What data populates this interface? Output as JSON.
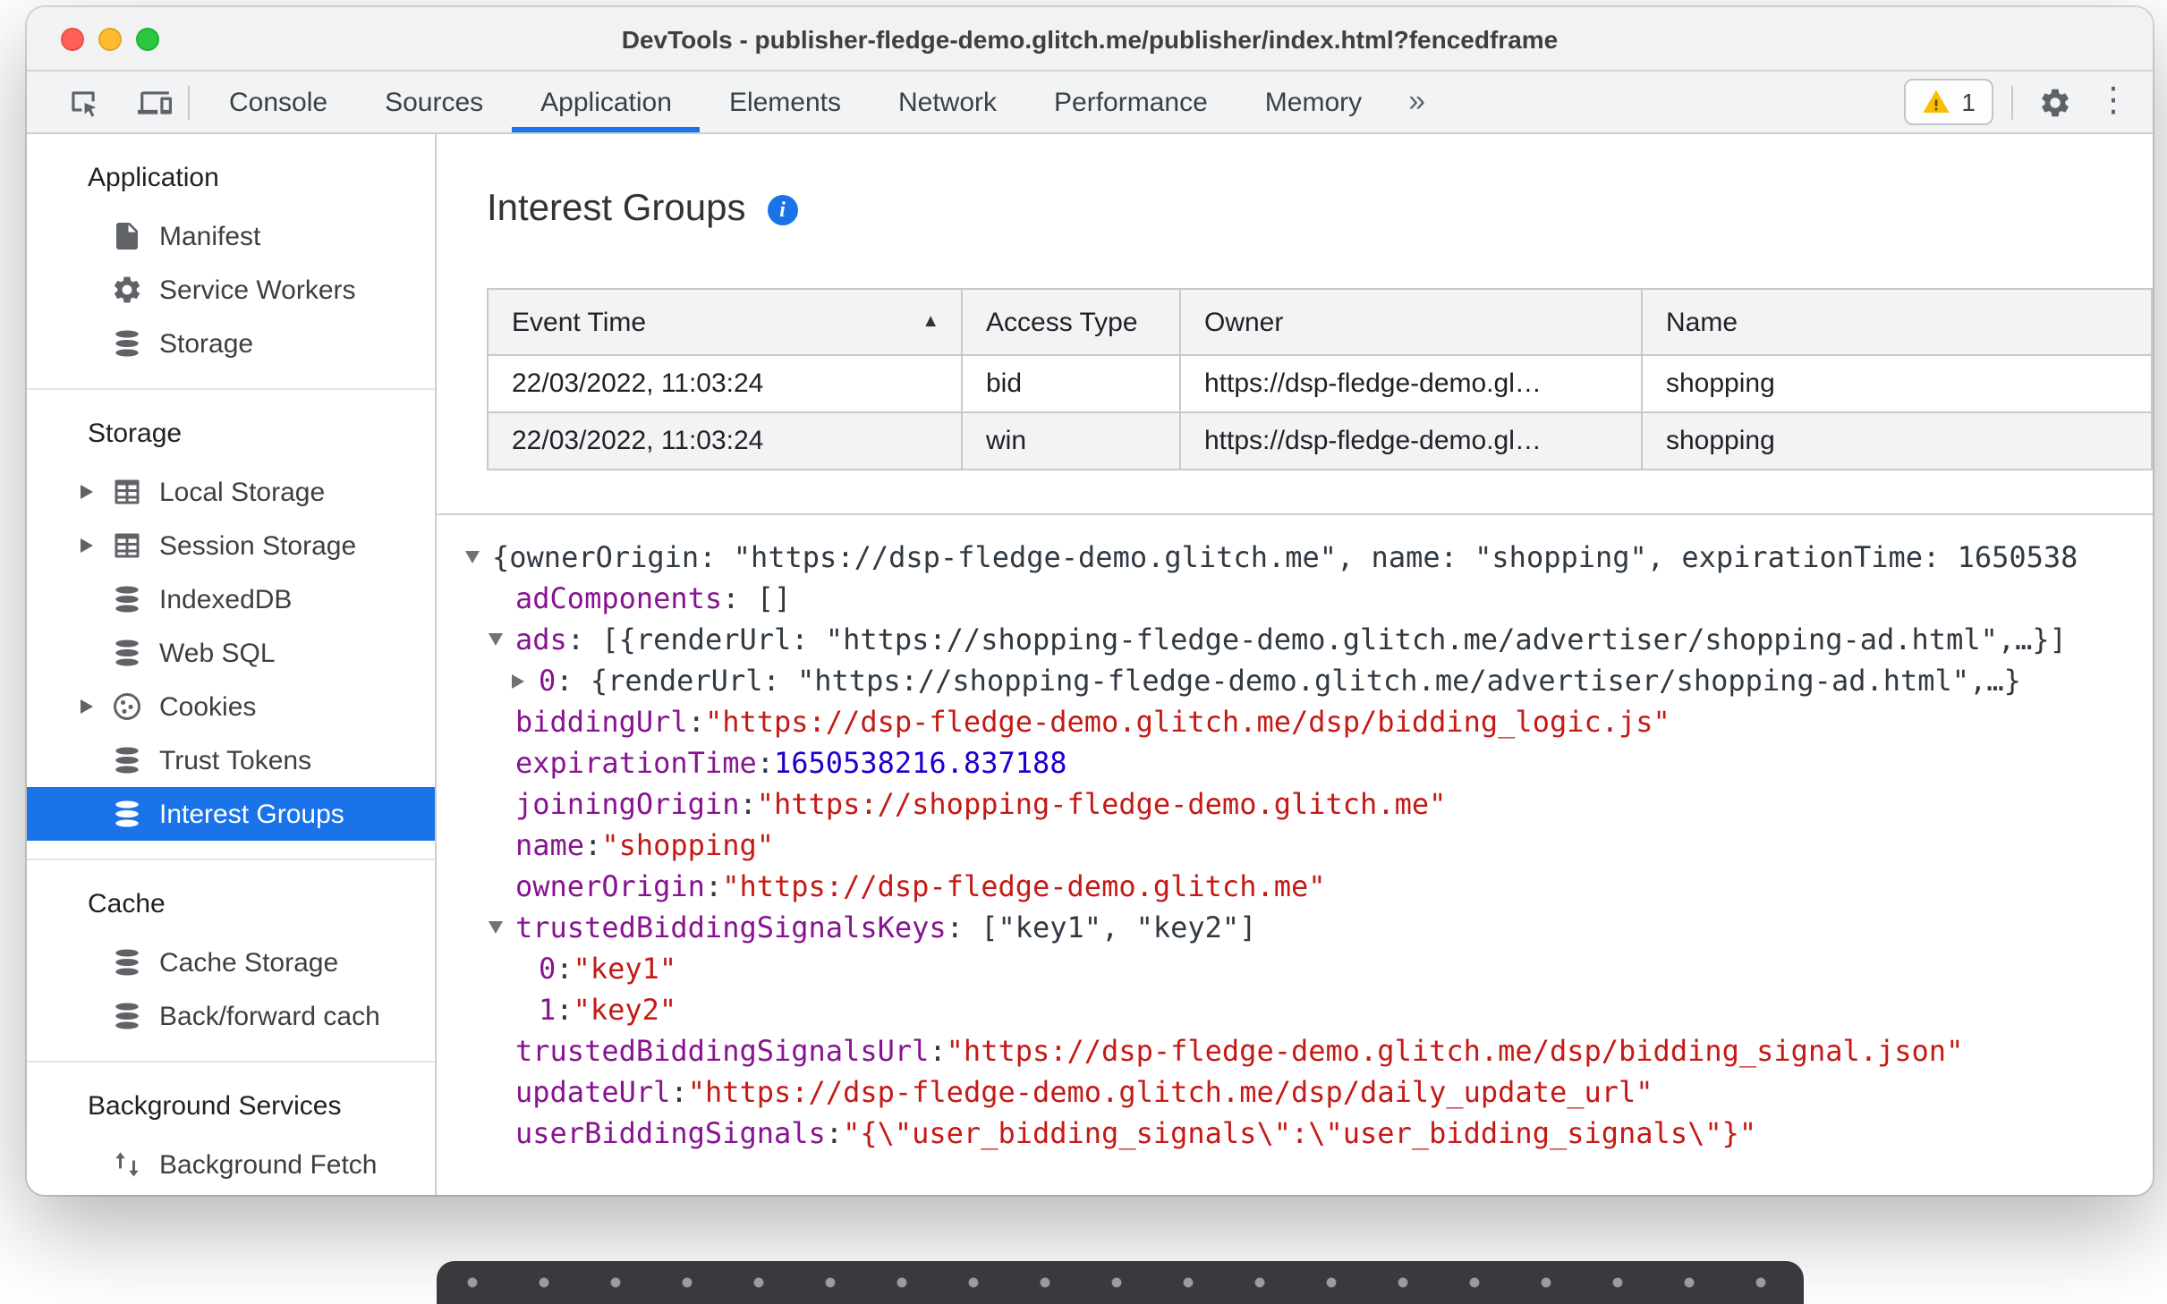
{
  "colors": {
    "accent": "#1a73e8",
    "tree_key": "#881391",
    "tree_string": "#c41a16",
    "tree_number": "#1c00cf",
    "warning": "#fbbc04",
    "selected_bg": "#1a73e8",
    "selected_text": "#ffffff"
  },
  "window": {
    "title": "DevTools - publisher-fledge-demo.glitch.me/publisher/index.html?fencedframe"
  },
  "toolbar": {
    "left_icons": [
      "inspect-icon",
      "device-toolbar-icon"
    ],
    "tabs": [
      {
        "label": "Console",
        "active": false
      },
      {
        "label": "Sources",
        "active": false
      },
      {
        "label": "Application",
        "active": true
      },
      {
        "label": "Elements",
        "active": false
      },
      {
        "label": "Network",
        "active": false
      },
      {
        "label": "Performance",
        "active": false
      },
      {
        "label": "Memory",
        "active": false
      }
    ],
    "more_tabs_glyph": "»",
    "warning_count": "1",
    "right_icons": [
      "warning-icon",
      "settings-gear-icon",
      "more-options-kebab-icon"
    ],
    "kebab_glyph": "⋮"
  },
  "sidebar": {
    "sections": [
      {
        "header": "Application",
        "items": [
          {
            "label": "Manifest",
            "icon": "file-icon",
            "chevron": false,
            "selected": false
          },
          {
            "label": "Service Workers",
            "icon": "gear-icon",
            "chevron": false,
            "selected": false
          },
          {
            "label": "Storage",
            "icon": "database-icon",
            "chevron": false,
            "selected": false
          }
        ]
      },
      {
        "header": "Storage",
        "items": [
          {
            "label": "Local Storage",
            "icon": "table-icon",
            "chevron": true,
            "selected": false
          },
          {
            "label": "Session Storage",
            "icon": "table-icon",
            "chevron": true,
            "selected": false
          },
          {
            "label": "IndexedDB",
            "icon": "database-icon",
            "chevron": false,
            "selected": false
          },
          {
            "label": "Web SQL",
            "icon": "database-icon",
            "chevron": false,
            "selected": false
          },
          {
            "label": "Cookies",
            "icon": "cookie-icon",
            "chevron": true,
            "selected": false
          },
          {
            "label": "Trust Tokens",
            "icon": "database-icon",
            "chevron": false,
            "selected": false
          },
          {
            "label": "Interest Groups",
            "icon": "database-icon",
            "chevron": false,
            "selected": true
          }
        ]
      },
      {
        "header": "Cache",
        "items": [
          {
            "label": "Cache Storage",
            "icon": "database-icon",
            "chevron": false,
            "selected": false
          },
          {
            "label": "Back/forward cach",
            "icon": "database-icon",
            "chevron": false,
            "selected": false
          }
        ]
      },
      {
        "header": "Background Services",
        "items": [
          {
            "label": "Background Fetch",
            "icon": "fetch-arrows-icon",
            "chevron": false,
            "selected": false
          }
        ]
      }
    ]
  },
  "main": {
    "title": "Interest Groups",
    "title_icon": "info-icon",
    "table": {
      "columns": [
        "Event Time",
        "Access Type",
        "Owner",
        "Name"
      ],
      "sort": {
        "column": "Event Time",
        "direction": "ascending",
        "glyph": "▲"
      },
      "rows": [
        [
          "22/03/2022, 11:03:24",
          "bid",
          "https://dsp-fledge-demo.gl…",
          "shopping"
        ],
        [
          "22/03/2022, 11:03:24",
          "win",
          "https://dsp-fledge-demo.gl…",
          "shopping"
        ]
      ]
    },
    "tree": [
      {
        "indent": 0,
        "arrow": "down",
        "segments": [
          {
            "cls": "plain",
            "text": "{ownerOrigin: \"https://dsp-fledge-demo.glitch.me\", name: \"shopping\", expirationTime: 1650538"
          }
        ]
      },
      {
        "indent": 1,
        "arrow": null,
        "segments": [
          {
            "cls": "key",
            "text": "adComponents"
          },
          {
            "cls": "plain",
            "text": ": []"
          }
        ]
      },
      {
        "indent": 1,
        "arrow": "down",
        "segments": [
          {
            "cls": "key",
            "text": "ads"
          },
          {
            "cls": "plain",
            "text": ": [{renderUrl: \"https://shopping-fledge-demo.glitch.me/advertiser/shopping-ad.html\",…}]"
          }
        ]
      },
      {
        "indent": 2,
        "arrow": "right",
        "segments": [
          {
            "cls": "key",
            "text": "0"
          },
          {
            "cls": "plain",
            "text": ": {renderUrl: \"https://shopping-fledge-demo.glitch.me/advertiser/shopping-ad.html\",…}"
          }
        ]
      },
      {
        "indent": 1,
        "arrow": null,
        "segments": [
          {
            "cls": "key",
            "text": "biddingUrl"
          },
          {
            "cls": "plain",
            "text": ": "
          },
          {
            "cls": "string",
            "text": "\"https://dsp-fledge-demo.glitch.me/dsp/bidding_logic.js\""
          }
        ]
      },
      {
        "indent": 1,
        "arrow": null,
        "segments": [
          {
            "cls": "key",
            "text": "expirationTime"
          },
          {
            "cls": "plain",
            "text": ": "
          },
          {
            "cls": "number",
            "text": "1650538216.837188"
          }
        ]
      },
      {
        "indent": 1,
        "arrow": null,
        "segments": [
          {
            "cls": "key",
            "text": "joiningOrigin"
          },
          {
            "cls": "plain",
            "text": ": "
          },
          {
            "cls": "string",
            "text": "\"https://shopping-fledge-demo.glitch.me\""
          }
        ]
      },
      {
        "indent": 1,
        "arrow": null,
        "segments": [
          {
            "cls": "key",
            "text": "name"
          },
          {
            "cls": "plain",
            "text": ": "
          },
          {
            "cls": "string",
            "text": "\"shopping\""
          }
        ]
      },
      {
        "indent": 1,
        "arrow": null,
        "segments": [
          {
            "cls": "key",
            "text": "ownerOrigin"
          },
          {
            "cls": "plain",
            "text": ": "
          },
          {
            "cls": "string",
            "text": "\"https://dsp-fledge-demo.glitch.me\""
          }
        ]
      },
      {
        "indent": 1,
        "arrow": "down",
        "segments": [
          {
            "cls": "key",
            "text": "trustedBiddingSignalsKeys"
          },
          {
            "cls": "plain",
            "text": ": [\"key1\", \"key2\"]"
          }
        ]
      },
      {
        "indent": 2,
        "arrow": null,
        "segments": [
          {
            "cls": "key",
            "text": "0"
          },
          {
            "cls": "plain",
            "text": ": "
          },
          {
            "cls": "string",
            "text": "\"key1\""
          }
        ]
      },
      {
        "indent": 2,
        "arrow": null,
        "segments": [
          {
            "cls": "key",
            "text": "1"
          },
          {
            "cls": "plain",
            "text": ": "
          },
          {
            "cls": "string",
            "text": "\"key2\""
          }
        ]
      },
      {
        "indent": 1,
        "arrow": null,
        "segments": [
          {
            "cls": "key",
            "text": "trustedBiddingSignalsUrl"
          },
          {
            "cls": "plain",
            "text": ": "
          },
          {
            "cls": "string",
            "text": "\"https://dsp-fledge-demo.glitch.me/dsp/bidding_signal.json\""
          }
        ]
      },
      {
        "indent": 1,
        "arrow": null,
        "segments": [
          {
            "cls": "key",
            "text": "updateUrl"
          },
          {
            "cls": "plain",
            "text": ": "
          },
          {
            "cls": "string",
            "text": "\"https://dsp-fledge-demo.glitch.me/dsp/daily_update_url\""
          }
        ]
      },
      {
        "indent": 1,
        "arrow": null,
        "segments": [
          {
            "cls": "key",
            "text": "userBiddingSignals"
          },
          {
            "cls": "plain",
            "text": ": "
          },
          {
            "cls": "string",
            "text": "\"{\\\"user_bidding_signals\\\":\\\"user_bidding_signals\\\"}\""
          }
        ]
      }
    ]
  }
}
